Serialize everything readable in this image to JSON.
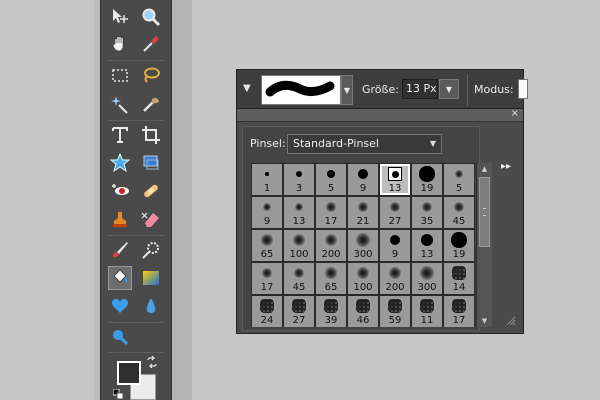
{
  "options_bar": {
    "size_label": "Größe:",
    "size_value": "13 Px",
    "mode_label": "Modus:"
  },
  "panel": {
    "close_glyph": "×",
    "brush_set_label": "Pinsel:",
    "brush_set_value": "Standard-Pinsel",
    "expand_glyph": "▸▸",
    "selected_brush_index": 4,
    "brushes": [
      {
        "size": "1",
        "kind": "hard"
      },
      {
        "size": "3",
        "kind": "hard"
      },
      {
        "size": "5",
        "kind": "hard"
      },
      {
        "size": "9",
        "kind": "hard"
      },
      {
        "size": "13",
        "kind": "hard"
      },
      {
        "size": "19",
        "kind": "hard"
      },
      {
        "size": "5",
        "kind": "soft"
      },
      {
        "size": "9",
        "kind": "soft"
      },
      {
        "size": "13",
        "kind": "soft"
      },
      {
        "size": "17",
        "kind": "soft"
      },
      {
        "size": "21",
        "kind": "soft"
      },
      {
        "size": "27",
        "kind": "soft"
      },
      {
        "size": "35",
        "kind": "soft"
      },
      {
        "size": "45",
        "kind": "soft"
      },
      {
        "size": "65",
        "kind": "soft"
      },
      {
        "size": "100",
        "kind": "soft"
      },
      {
        "size": "200",
        "kind": "soft"
      },
      {
        "size": "300",
        "kind": "soft"
      },
      {
        "size": "9",
        "kind": "hard"
      },
      {
        "size": "13",
        "kind": "hard"
      },
      {
        "size": "19",
        "kind": "hard"
      },
      {
        "size": "17",
        "kind": "soft"
      },
      {
        "size": "45",
        "kind": "soft"
      },
      {
        "size": "65",
        "kind": "soft"
      },
      {
        "size": "100",
        "kind": "soft"
      },
      {
        "size": "200",
        "kind": "soft"
      },
      {
        "size": "300",
        "kind": "soft"
      },
      {
        "size": "14",
        "kind": "texture"
      },
      {
        "size": "24",
        "kind": "texture"
      },
      {
        "size": "27",
        "kind": "texture"
      },
      {
        "size": "39",
        "kind": "texture"
      },
      {
        "size": "46",
        "kind": "texture"
      },
      {
        "size": "59",
        "kind": "texture"
      },
      {
        "size": "11",
        "kind": "texture"
      },
      {
        "size": "17",
        "kind": "texture"
      }
    ]
  },
  "toolbox": {
    "tools": [
      {
        "name": "move-icon"
      },
      {
        "name": "zoom-icon"
      },
      {
        "name": "hand-icon"
      },
      {
        "name": "eyedropper-icon"
      },
      {
        "name": "marquee-icon"
      },
      {
        "name": "lasso-icon"
      },
      {
        "name": "magic-wand-icon"
      },
      {
        "name": "quick-selection-icon"
      },
      {
        "name": "text-icon"
      },
      {
        "name": "crop-icon"
      },
      {
        "name": "cookie-cutter-icon"
      },
      {
        "name": "straighten-icon"
      },
      {
        "name": "red-eye-icon"
      },
      {
        "name": "healing-brush-icon"
      },
      {
        "name": "clone-stamp-icon"
      },
      {
        "name": "eraser-icon"
      },
      {
        "name": "brush-icon"
      },
      {
        "name": "smart-brush-icon"
      },
      {
        "name": "paint-bucket-icon"
      },
      {
        "name": "gradient-icon"
      },
      {
        "name": "custom-shape-icon"
      },
      {
        "name": "blur-icon"
      },
      {
        "name": "sponge-icon"
      }
    ],
    "active_tool": "paint-bucket-icon",
    "foreground_color": "#2e2e2e",
    "background_color": "#ececec"
  }
}
